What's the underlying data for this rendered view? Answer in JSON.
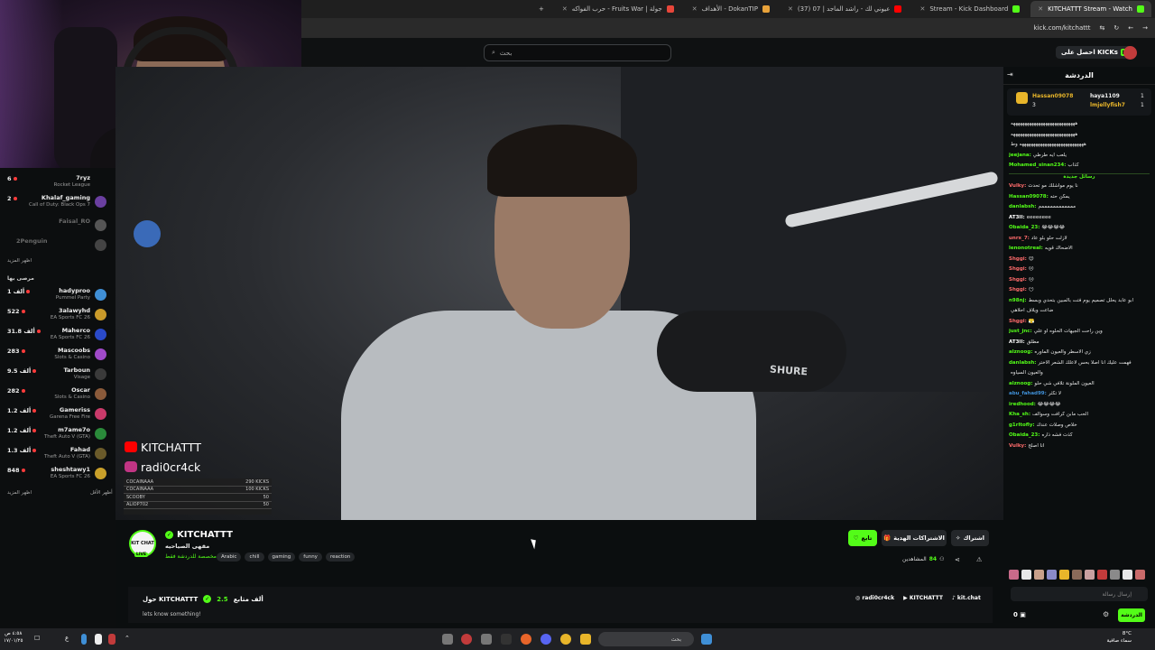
{
  "browser": {
    "tabs": [
      {
        "label": "KITCHATTT Stream - Watch",
        "color": "#53fc18",
        "active": true
      },
      {
        "label": "Stream - Kick Dashboard",
        "color": "#53fc18",
        "active": false
      },
      {
        "label": "(37) عيوني لك - راشد الماجد | 07",
        "color": "#ff0000",
        "active": false
      },
      {
        "label": "الأهداف - DokanTIP",
        "color": "#e8a23a",
        "active": false
      },
      {
        "label": "حرب الفواكه - Fruits War | جولة",
        "color": "#e8463a",
        "active": false
      }
    ],
    "new_tab": "+",
    "url": "kick.com/kitchattt"
  },
  "nav": {
    "search_placeholder": "بحث",
    "get_kicks": "احصل على KICKs"
  },
  "sidebar": {
    "channels_top": [
      {
        "viewers": "6",
        "name": "7ryz",
        "game": "Rocket League",
        "color": "#2e6bd6",
        "offline": false
      },
      {
        "viewers": "2",
        "name": "Khalaf_gaming",
        "game": "Call of Duty: Black Ops 7",
        "color": "#6a3fa0",
        "offline": false
      },
      {
        "viewers": "",
        "name": "Faisal_RO",
        "game": "",
        "color": "#555",
        "offline": true
      },
      {
        "viewers": "",
        "name": "2Penguin",
        "game": "",
        "color": "#444",
        "offline": true
      }
    ],
    "show_more_1": "اظهر المزيد",
    "recommended_title": "مرصى بها",
    "channels_rec": [
      {
        "viewers": "1 ألف",
        "name": "hadyproo",
        "game": "Pummel Party",
        "color": "#3f8fd6"
      },
      {
        "viewers": "522",
        "name": "3alawyhd",
        "game": "EA Sports FC 26",
        "color": "#c99a2a"
      },
      {
        "viewers": "31.8 ألف",
        "name": "Maherco",
        "game": "EA Sports FC 26",
        "color": "#2a4ac9"
      },
      {
        "viewers": "283",
        "name": "Mascoobs",
        "game": "Slots & Casino",
        "color": "#a04ac9"
      },
      {
        "viewers": "9.5 ألف",
        "name": "Tarboun",
        "game": "Visage",
        "color": "#3a3a3a"
      },
      {
        "viewers": "282",
        "name": "Oscar",
        "game": "Slots & Casino",
        "color": "#8a5a3a"
      },
      {
        "viewers": "1.2 ألف",
        "name": "Gameriss",
        "game": "Garena Free Fire",
        "color": "#c93a6a"
      },
      {
        "viewers": "1.2 ألف",
        "name": "m7ame7o",
        "game": "Theft Auto V (GTA)",
        "color": "#2a8a3a"
      },
      {
        "viewers": "1.3 ألف",
        "name": "Fahad",
        "game": "Theft Auto V (GTA)",
        "color": "#6a5a2a"
      },
      {
        "viewers": "848",
        "name": "sheshtawy1",
        "game": "EA Sports FC 26",
        "color": "#c9a02a"
      }
    ],
    "show_more_2": "اظهر المزيد",
    "show_less": "أظهر الأقل"
  },
  "overlay": {
    "youtube": "KITCHATTT",
    "instagram": "radi0cr4ck",
    "list": [
      {
        "name": "COCAINAAA",
        "val": "290 KICKS"
      },
      {
        "name": "COCAINAAA",
        "val": "100 KICKS"
      },
      {
        "name": "SCOOBY",
        "val": "50"
      },
      {
        "name": "ALIOP702",
        "val": "50"
      }
    ],
    "mic_brand": "SHURE"
  },
  "stream": {
    "channel_avatar": "KIT CHAT",
    "live_badge": "LIVE",
    "channel_name": "KITCHATTT",
    "title": "مقهى الصياحيه",
    "category": "مخصصة للدردشة فقط",
    "tags": [
      "Arabic",
      "chill",
      "gaming",
      "funny",
      "reaction"
    ],
    "follow_label": "تابع",
    "gift_label": "الاشتراكات الهدية",
    "subscribe_label": "اشتراك",
    "viewers_label": "المشاهدين",
    "viewers_count": "84",
    "about_label": "حول KITCHATTT",
    "followers_count": "2.5",
    "followers_label": "ألف متابع",
    "description": "lets know something!",
    "links": [
      "radi0cr4ck",
      "KITCHATTT",
      "kit.chat"
    ]
  },
  "chat": {
    "header": "الدردشة",
    "pinned": [
      {
        "name": "Hassan09078",
        "count": "3"
      },
      {
        "name": "haya1109",
        "count": "1"
      },
      {
        "name": "lmjellyfish7",
        "count": "1"
      }
    ],
    "lines": [
      {
        "user": "",
        "text": "ههههههههههههههههههههههههههههه",
        "color": "#fff"
      },
      {
        "user": "",
        "text": "ههههههههههههههههههههههههههههه",
        "color": "#fff"
      },
      {
        "user": "",
        "text": "ههههههههههههههههههههههههههههه وط",
        "color": "#fff"
      },
      {
        "user": "jeejana:",
        "text": "يلعب ايه طرطي",
        "color": "#53fc18"
      },
      {
        "user": "Mohamed_sinan234:",
        "text": "كذاب",
        "color": "#53fc18"
      },
      {
        "user": "",
        "text": "رسائل جديدة",
        "color": "#53fc18",
        "sep": true
      },
      {
        "user": "Vulky:",
        "text": "نا يوم مواشلك مو تحدث",
        "color": "#ff6b6b"
      },
      {
        "user": "Hassan09078:",
        "text": "يمكن حته",
        "color": "#53fc18"
      },
      {
        "user": "danlabsh:",
        "text": "ممممممممممممم",
        "color": "#53fc18"
      },
      {
        "user": "AT3II:",
        "text": "eeeeeeee",
        "color": "#fff"
      },
      {
        "user": "Obaida_23:",
        "text": "😂😂😂😂",
        "color": "#53fc18"
      },
      {
        "user": "unrx_7:",
        "text": "لازلت حلو بلو عاد",
        "color": "#ff6b6b"
      },
      {
        "user": "lenonotreal:",
        "text": "الاضحاك قويه",
        "color": "#53fc18"
      },
      {
        "user": "Shggi:",
        "text": "😊",
        "color": "#ff6b6b"
      },
      {
        "user": "Shggi:",
        "text": "😐",
        "color": "#ff6b6b"
      },
      {
        "user": "Shggi:",
        "text": "😑",
        "color": "#ff6b6b"
      },
      {
        "user": "Shggi:",
        "text": "😶",
        "color": "#ff6b6b"
      },
      {
        "user": "n98nj:",
        "text": "ابو عابد يحلل تصميم يوم فتت بالمبين بتحدي وبسط",
        "color": "#53fc18"
      },
      {
        "user": "",
        "text": "ضاعت ويلاف احلاهي",
        "color": "#fff"
      },
      {
        "user": "Shggi:",
        "text": "😤",
        "color": "#ff6b6b"
      },
      {
        "user": "just_jnc:",
        "text": "وين راحت الجيهات الحلوه او علي",
        "color": "#53fc18"
      },
      {
        "user": "AT3II:",
        "text": "مطلق",
        "color": "#fff"
      },
      {
        "user": "alznoog:",
        "text": "زي الاسطر والعيون الماوره",
        "color": "#53fc18"
      },
      {
        "user": "danlabsh:",
        "text": "فهمت عليك انا اصلا بحس لاعلك الشعر الاختر",
        "color": "#53fc18"
      },
      {
        "user": "",
        "text": "والعيون السياوه",
        "color": "#fff"
      },
      {
        "user": "alznoog:",
        "text": "العيون الملونة تلافي شي حلو",
        "color": "#53fc18"
      },
      {
        "user": "abu_fahad99:",
        "text": "لا تكثر",
        "color": "#3f8fd6"
      },
      {
        "user": "iredhood:",
        "text": "😂😂😂😂",
        "color": "#53fc18"
      },
      {
        "user": "Kha_sh:",
        "text": "الحب مابن كرافت وسوالف",
        "color": "#53fc18"
      },
      {
        "user": "g1rltofly:",
        "text": "خلاص وصلات عندك",
        "color": "#53fc18"
      },
      {
        "user": "Obaida_23:",
        "text": "كذت فشه ذاره",
        "color": "#53fc18"
      },
      {
        "user": "Vulky:",
        "text": "انا اصلح",
        "color": "#ff6b6b"
      }
    ],
    "input_placeholder": "إرسال رسالة",
    "send_label": "الدردشة",
    "count": "0"
  },
  "taskbar": {
    "time": "٤:٥٨ ص",
    "date": "١٧/٠١/٢٥",
    "lang": "ع",
    "search": "بحث",
    "weather_temp": "8°C",
    "weather_desc": "سماء صافية"
  }
}
